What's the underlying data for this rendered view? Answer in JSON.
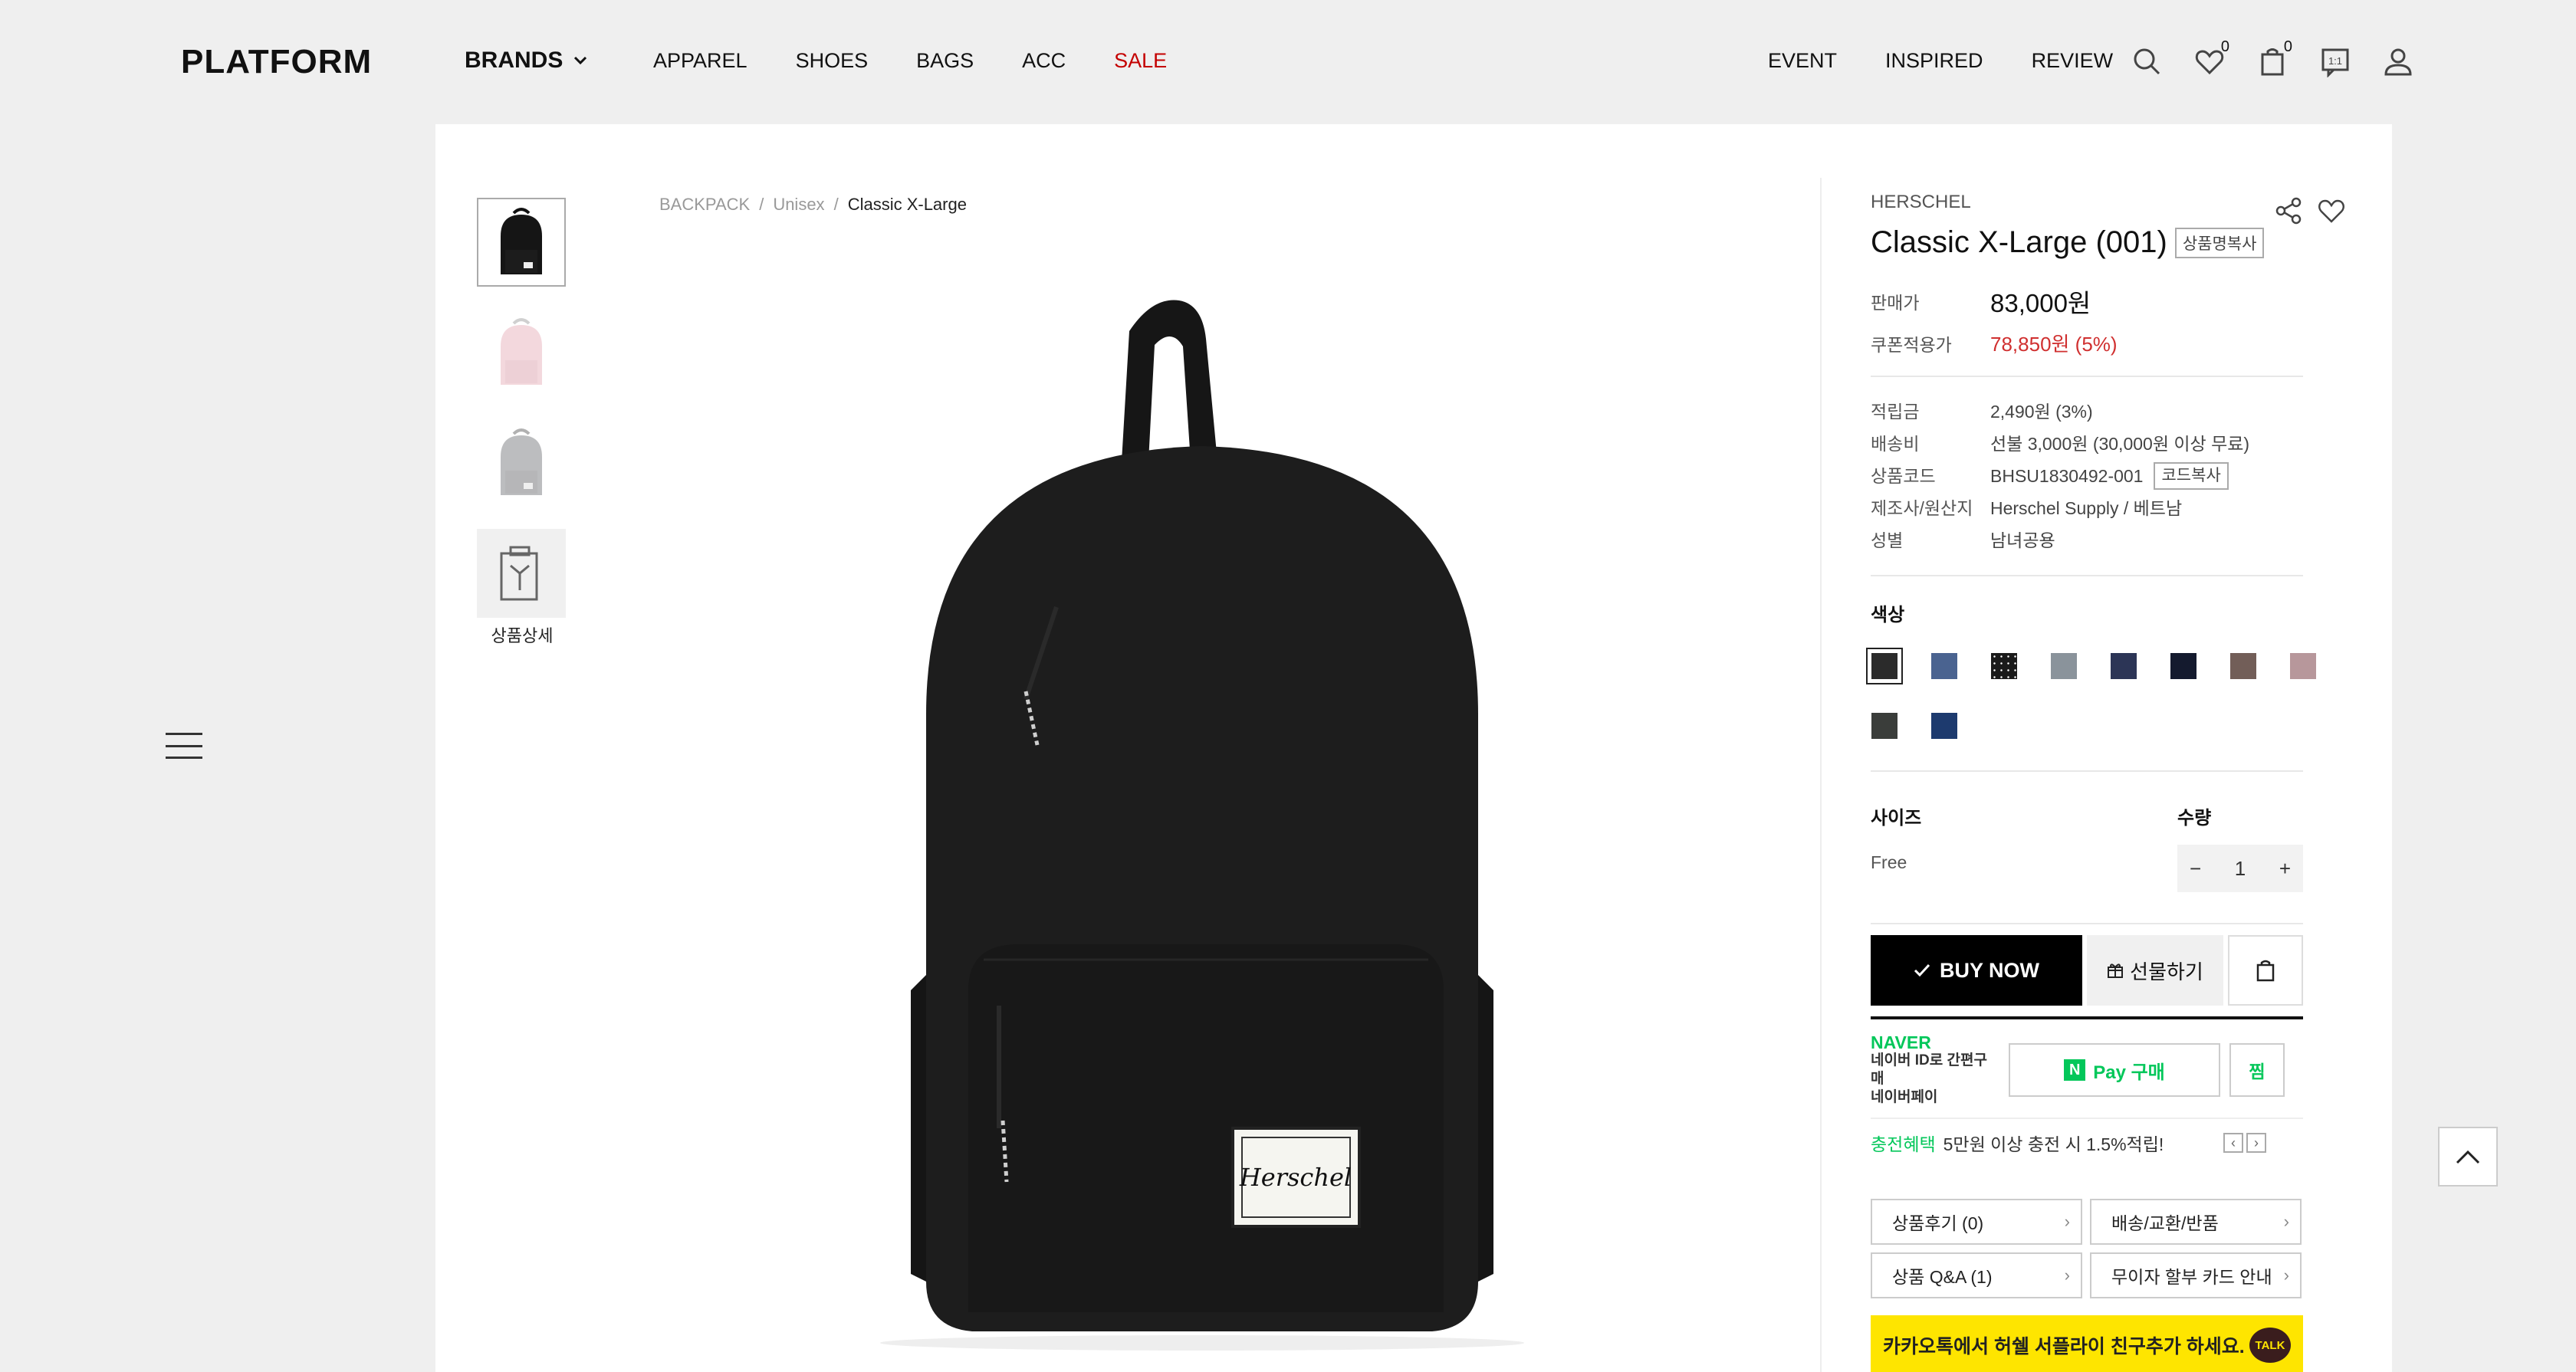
{
  "header": {
    "logo": "PLATFORM",
    "brands": "BRANDS",
    "nav_left": [
      "APPAREL",
      "SHOES",
      "BAGS",
      "ACC",
      "SALE"
    ],
    "nav_right": [
      "EVENT",
      "INSPIRED",
      "REVIEW"
    ],
    "wishlist_count": "0",
    "cart_count": "0"
  },
  "thumbs": {
    "detail_caption": "상품상세"
  },
  "breadcrumb": [
    "BACKPACK",
    "Unisex",
    "Classic X-Large"
  ],
  "breadcrumb_sep": "/",
  "product": {
    "brand": "HERSCHEL",
    "title": "Classic X-Large (001)",
    "copy_name_label": "상품명복사",
    "price_label": "판매가",
    "price": "83,000원",
    "coupon_label": "쿠폰적용가",
    "coupon_price": "78,850원 (5%)",
    "specs": [
      {
        "label": "적립금",
        "value": "2,490원 (3%)"
      },
      {
        "label": "배송비",
        "value": "선불 3,000원 (30,000원 이상 무료)"
      },
      {
        "label": "상품코드",
        "value": "BHSU1830492-001"
      },
      {
        "label": "제조사/원산지",
        "value": "Herschel Supply / 베트남"
      },
      {
        "label": "성별",
        "value": "남녀공용"
      }
    ],
    "code_copy_label": "코드복사",
    "color_title": "색상",
    "colors": [
      "#2b2b2b",
      "#4a6390",
      "#1a1a1a",
      "#8a939b",
      "#2c3556",
      "#141a2e",
      "#725e58",
      "#b7979b",
      "#3a3d3a",
      "#1d3a6e"
    ],
    "size_title": "사이즈",
    "size_value": "Free",
    "qty_title": "수량",
    "qty_minus": "−",
    "qty_value": "1",
    "qty_plus": "+"
  },
  "actions": {
    "buy_now": "BUY NOW",
    "gift": "선물하기"
  },
  "npay": {
    "naver": "NAVER",
    "line1": "네이버 ID로 간편구매",
    "line2": "네이버페이",
    "pay_label": "Pay 구매",
    "n_mark": "N",
    "jjim": "찜",
    "charge_label": "충전혜택",
    "charge_text": "5만원 이상 충전 시 1.5%적립!",
    "prev": "‹",
    "next": "›"
  },
  "info_links": [
    "상품후기 (0)",
    "배송/교환/반품",
    "상품 Q&A (1)",
    "무이자 할부 카드 안내"
  ],
  "kakao": {
    "text": "카카오톡에서 허쉘 서플라이 친구추가 하세요.",
    "talk": "TALK"
  }
}
